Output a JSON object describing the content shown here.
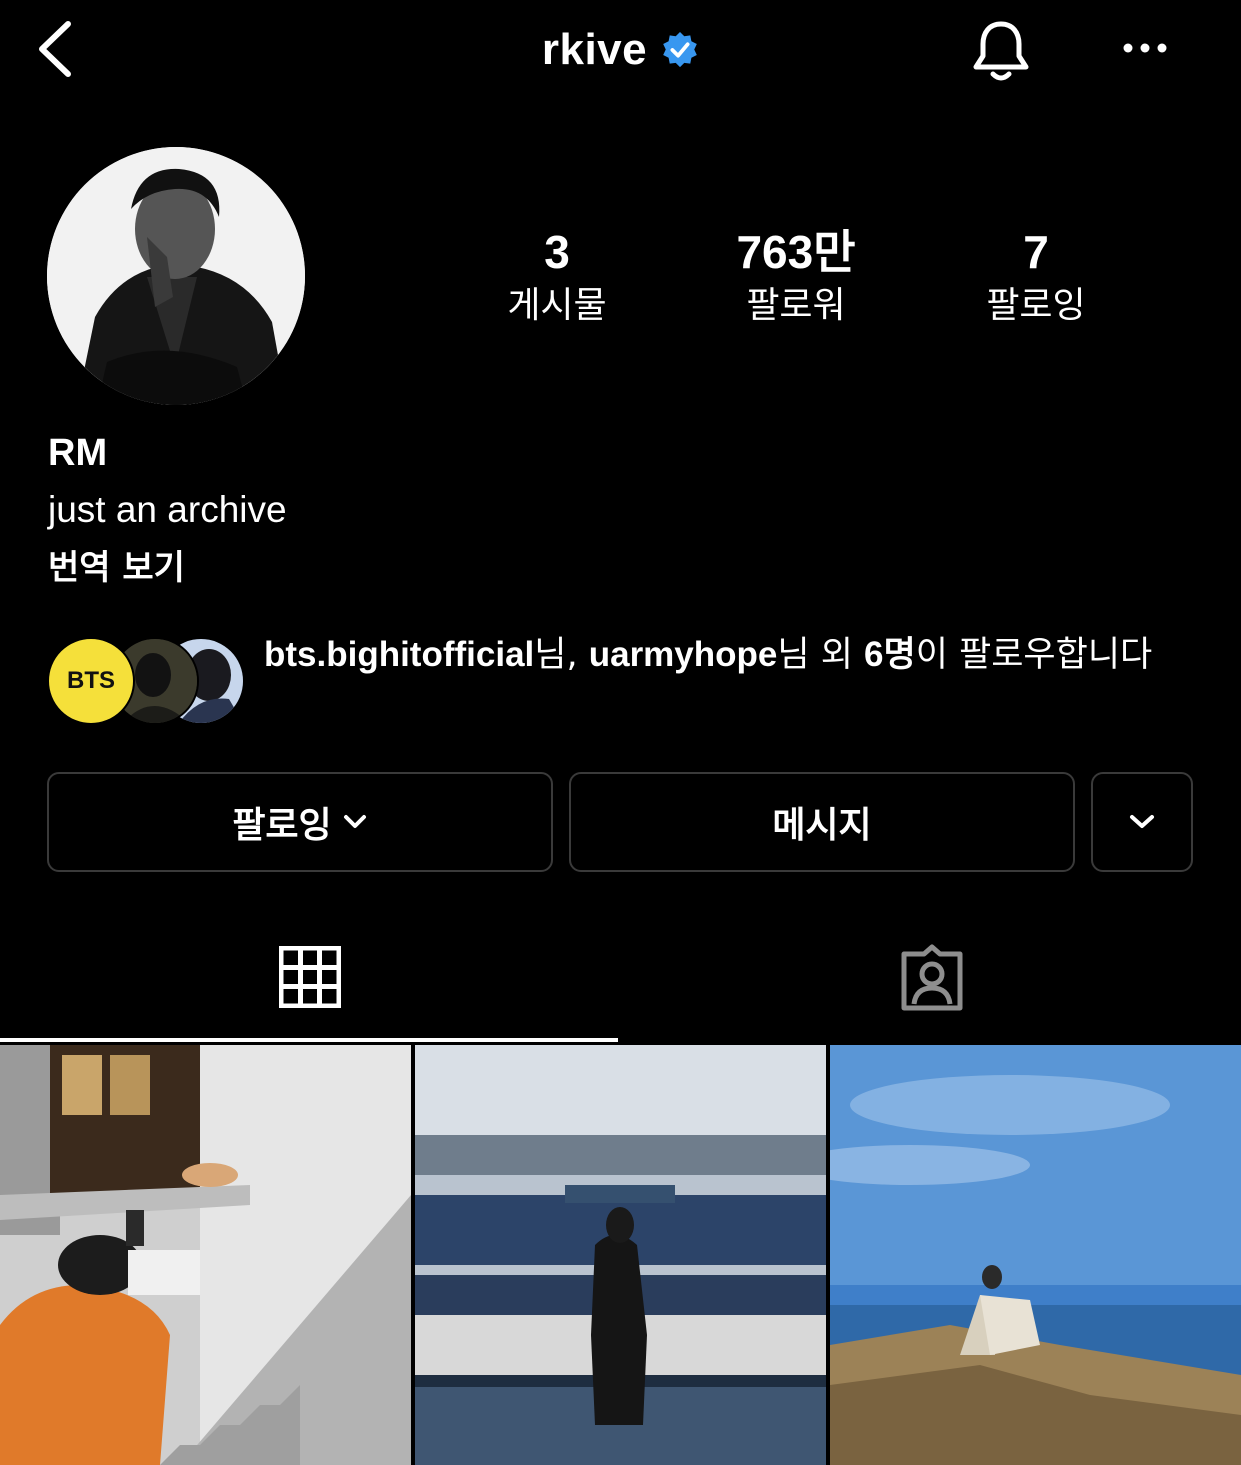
{
  "header": {
    "username": "rkive",
    "verified": true,
    "icons": {
      "back": "back-chevron-icon",
      "bell": "bell-icon",
      "more": "more-dots-icon",
      "verified": "verified-badge-icon"
    }
  },
  "profile": {
    "avatar_icon": "profile-avatar",
    "stats": [
      {
        "value": "3",
        "label": "게시물"
      },
      {
        "value": "763만",
        "label": "팔로워"
      },
      {
        "value": "7",
        "label": "팔로잉"
      }
    ],
    "name": "RM",
    "bio": "just an archive",
    "translate": "번역 보기"
  },
  "followed_by": {
    "account1": "bts.bighitofficial",
    "suffix1": "님, ",
    "account2": "uarmyhope",
    "suffix2": "님 외 ",
    "count": "6명",
    "suffix3": "이 팔로우합니다",
    "avatar1_text": "BTS"
  },
  "buttons": {
    "following": "팔로잉",
    "message": "메시지"
  },
  "tabs": [
    {
      "name": "posts-grid",
      "icon": "grid-icon",
      "active": true
    },
    {
      "name": "tagged",
      "icon": "tagged-person-icon",
      "active": false
    }
  ],
  "colors": {
    "background": "#000000",
    "verified": "#3897f0",
    "bts_yellow": "#f5e03a",
    "button_border": "#3a3a3a"
  }
}
